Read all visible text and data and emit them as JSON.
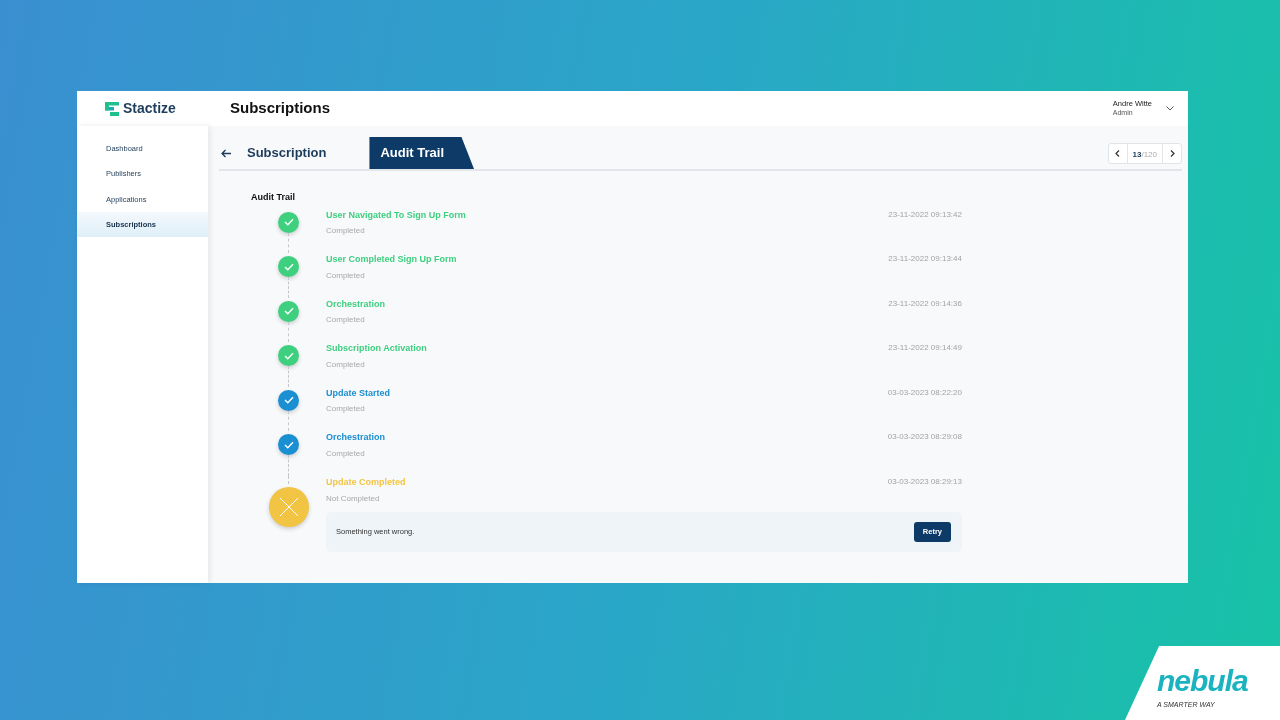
{
  "header": {
    "logo_text": "Stactize",
    "title": "Subscriptions",
    "user": {
      "name": "Andre Witte",
      "role": "Admin"
    }
  },
  "sidebar": {
    "items": [
      {
        "label": "Dashboard",
        "selected": false
      },
      {
        "label": "Publishers",
        "selected": false
      },
      {
        "label": "Applications",
        "selected": false
      },
      {
        "label": "Subscriptions",
        "selected": true
      }
    ]
  },
  "tabs": [
    {
      "label": "Subscription",
      "selected": false
    },
    {
      "label": "Audit Trail",
      "selected": true
    }
  ],
  "pager": {
    "current": "13",
    "total": "/120"
  },
  "audit_trail": {
    "heading": "Audit Trail",
    "steps": [
      {
        "kind": "done",
        "title": "User Navigated To Sign Up Form",
        "status": "Completed",
        "time": "23-11-2022 09:13:42",
        "color": "#3ecf7f"
      },
      {
        "kind": "done",
        "title": "User Completed Sign Up Form",
        "status": "Completed",
        "time": "23-11-2022 09:13:44",
        "color": "#3ecf7f"
      },
      {
        "kind": "done",
        "title": "Orchestration",
        "status": "Completed",
        "time": "23-11-2022 09:14:36",
        "color": "#3ecf7f"
      },
      {
        "kind": "done",
        "title": "Subscription Activation",
        "status": "Completed",
        "time": "23-11-2022 09:14:49",
        "color": "#3ecf7f"
      },
      {
        "kind": "done",
        "title": "Update Started",
        "status": "Completed",
        "time": "03-03-2023 08:22:20",
        "color": "#1a8fd1"
      },
      {
        "kind": "done",
        "title": "Orchestration",
        "status": "Completed",
        "time": "03-03-2023 08:29:08",
        "color": "#1a8fd1"
      },
      {
        "kind": "failed",
        "title": "Update Completed",
        "status": "Not Completed",
        "time": "03-03-2023 08:29:13",
        "color": "#f2c443",
        "error": {
          "message": "Something went wrong.",
          "button": "Retry"
        }
      }
    ]
  },
  "brand": {
    "name": "nebula",
    "tagline": "A SMARTER WAY"
  }
}
